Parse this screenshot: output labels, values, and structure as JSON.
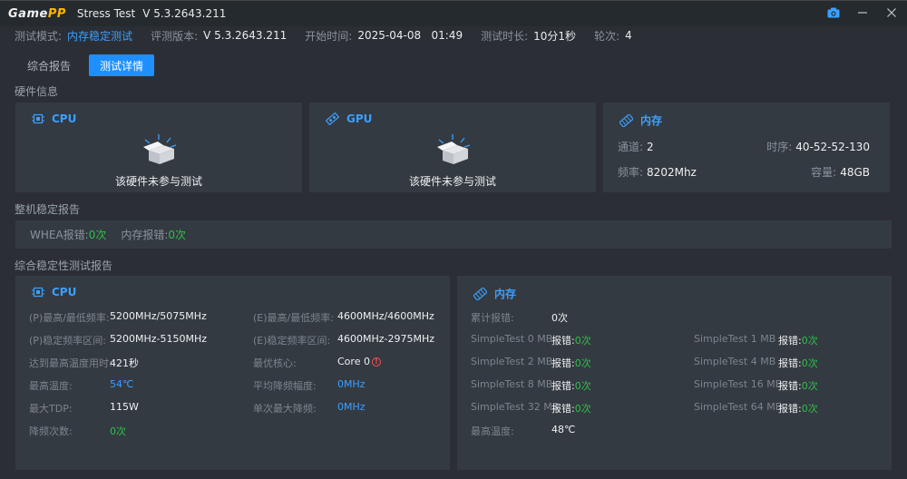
{
  "titlebar": {
    "logo_main": "Game",
    "logo_accent": "PP",
    "app_title": "Stress Test",
    "version": "V 5.3.2643.211"
  },
  "info": {
    "mode_label": "测试模式:",
    "mode_value": "内存稳定测试",
    "eval_label": "评测版本:",
    "eval_value": "V 5.3.2643.211",
    "start_label": "开始时间:",
    "start_value": "2025-04-08   01:49",
    "duration_label": "测试时长:",
    "duration_value": "10分1秒",
    "rounds_label": "轮次:",
    "rounds_value": "4"
  },
  "tabs": [
    {
      "label": "综合报告",
      "active": false
    },
    {
      "label": "测试详情",
      "active": true
    }
  ],
  "hardware": {
    "section_title": "硬件信息",
    "cpu": {
      "title": "CPU",
      "message": "该硬件未参与测试"
    },
    "gpu": {
      "title": "GPU",
      "message": "该硬件未参与测试"
    },
    "memory": {
      "title": "内存",
      "channel_label": "通道:",
      "channel_value": "2",
      "timing_label": "时序:",
      "timing_value": "40-52-52-130",
      "freq_label": "频率:",
      "freq_value": "8202Mhz",
      "capacity_label": "容量:",
      "capacity_value": "48GB"
    }
  },
  "stability": {
    "section_title": "整机稳定报告",
    "whea_label": "WHEA报错:",
    "whea_value": "0次",
    "mem_err_label": "内存报错:",
    "mem_err_value": "0次"
  },
  "report": {
    "section_title": "综合稳定性测试报告",
    "cpu": {
      "title": "CPU",
      "left": [
        {
          "label": "(P)最高/最低频率:",
          "value": "5200MHz/5075MHz",
          "color": "normal"
        },
        {
          "label": "(P)稳定频率区间:",
          "value": "5200MHz-5150MHz",
          "color": "normal"
        },
        {
          "label": "达到最高温度用时:",
          "value": "421秒",
          "color": "normal"
        },
        {
          "label": "最高温度:",
          "value": "54℃",
          "color": "blue"
        },
        {
          "label": "最大TDP:",
          "value": "115W",
          "color": "normal"
        },
        {
          "label": "降频次数:",
          "value": "0次",
          "color": "green"
        }
      ],
      "right": [
        {
          "label": "(E)最高/最低频率:",
          "value": "4600MHz/4600MHz",
          "color": "normal"
        },
        {
          "label": "(E)稳定频率区间:",
          "value": "4600MHz-2975MHz",
          "color": "normal"
        },
        {
          "label": "最优核心:",
          "value": "Core 0",
          "color": "normal"
        },
        {
          "label": "平均降频幅度:",
          "value": "0MHz",
          "color": "blue"
        },
        {
          "label": "单次最大降频:",
          "value": "0MHz",
          "color": "blue"
        }
      ]
    },
    "memory": {
      "title": "内存",
      "total_label": "累计报错:",
      "total_value": "0次",
      "err_label": "报错:",
      "tests": [
        {
          "name": "SimpleTest 0 MB",
          "value": "0次"
        },
        {
          "name": "SimpleTest 1 MB",
          "value": "0次"
        },
        {
          "name": "SimpleTest 2 MB",
          "value": "0次"
        },
        {
          "name": "SimpleTest 4 MB",
          "value": "0次"
        },
        {
          "name": "SimpleTest 8 MB",
          "value": "0次"
        },
        {
          "name": "SimpleTest 16 MB",
          "value": "0次"
        },
        {
          "name": "SimpleTest 32 MB",
          "value": "0次"
        },
        {
          "name": "SimpleTest 64 MB",
          "value": "0次"
        }
      ],
      "max_temp_label": "最高温度:",
      "max_temp_value": "48℃"
    }
  },
  "colors": {
    "accent": "#1e8fff",
    "blue_text": "#3aa0ff",
    "green_text": "#2fbf4a",
    "card_bg": "#343a41",
    "window_bg": "#2b2f35"
  }
}
